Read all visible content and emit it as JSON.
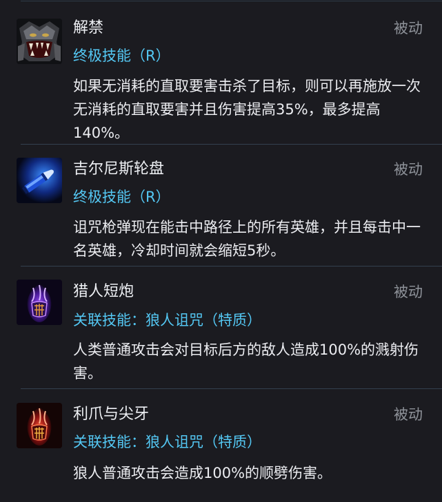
{
  "talents": [
    {
      "name": "解禁",
      "type": "被动",
      "subtitle": "终极技能（R）",
      "description": "如果无消耗的直取要害击杀了目标，则可以再施放一次无消耗的直取要害并且伤害提高35%，最多提高140%。",
      "icon": "beast-roar-icon"
    },
    {
      "name": "吉尔尼斯轮盘",
      "type": "被动",
      "subtitle": "终极技能（R）",
      "description": "诅咒枪弹现在能击中路径上的所有英雄，并且每击中一名英雄，冷却时间就会缩短5秒。",
      "icon": "bullet-icon"
    },
    {
      "name": "猎人短炮",
      "type": "被动",
      "subtitle": "关联技能：狼人诅咒（特质）",
      "description": "人类普通攻击会对目标后方的敌人造成100%的溅射伤害。",
      "icon": "purple-claw-icon"
    },
    {
      "name": "利爪与尖牙",
      "type": "被动",
      "subtitle": "关联技能：狼人诅咒（特质）",
      "description": "狼人普通攻击会造成100%的顺劈伤害。",
      "icon": "red-claw-icon"
    }
  ],
  "colors": {
    "background": "#1b1b20",
    "subtitle": "#54c8f4",
    "passive": "#8e9299",
    "divider": "#34414f"
  }
}
